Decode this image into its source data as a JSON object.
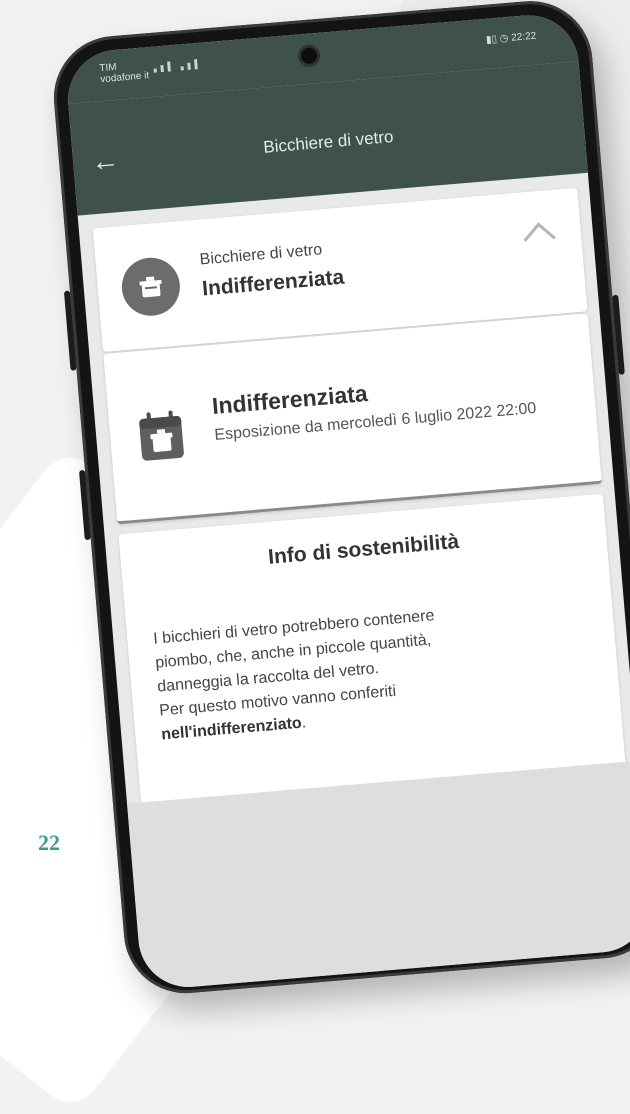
{
  "page": {
    "number": "22"
  },
  "status_bar": {
    "carrier": "TIM",
    "network": "vodafone it",
    "status_icons": "battery-wifi-icons",
    "time": "22:22"
  },
  "app_bar": {
    "title": "Bicchiere di vetro",
    "back_icon": "arrow-left-icon"
  },
  "header": {
    "item_name": "Bicchiere di vetro",
    "category": "Indifferenziata",
    "avatar_icon": "bin-icon",
    "toggle_icon": "chevron-up-icon"
  },
  "collection": {
    "title": "Indifferenziata",
    "detail": "Esposizione da mercoledì 6 luglio 2022 22:00",
    "icon": "calendar-bin-icon"
  },
  "sustainability": {
    "title": "Info di sostenibilità",
    "text_lines": [
      "I bicchieri di vetro potrebbero contenere",
      "piombo, che, anche in piccole quantità,",
      "danneggia la raccolta del vetro.",
      "Per questo motivo vanno conferiti"
    ],
    "text_bold": "nell'indifferenziato",
    "text_end": "."
  },
  "colors": {
    "appbar": "#3f514c",
    "accent_page_number": "#3f9b8e",
    "icon_gray": "#6c6c6c"
  }
}
